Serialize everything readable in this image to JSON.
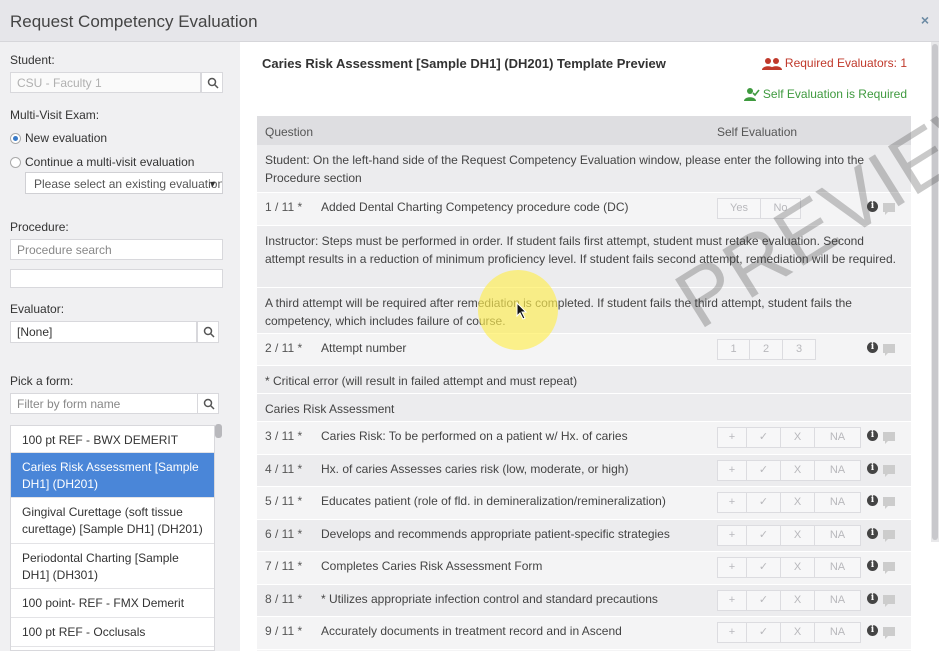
{
  "window": {
    "title": "Request Competency Evaluation",
    "close_glyph": "×"
  },
  "left": {
    "student_label": "Student:",
    "student_value": "CSU - Faculty 1",
    "multivisit_label": "Multi-Visit Exam:",
    "new_eval_label": "New evaluation",
    "continue_label": "Continue a multi-visit evaluation",
    "existing_select": "Please select an existing evaluation",
    "procedure_label": "Procedure:",
    "procedure_placeholder": "Procedure search",
    "evaluator_label": "Evaluator:",
    "evaluator_value": "[None]",
    "form_label": "Pick a form:",
    "form_filter_placeholder": "Filter by form name",
    "forms": [
      "100 pt REF - BWX DEMERIT",
      "Caries Risk Assessment [Sample DH1] (DH201)",
      "Gingival Curettage (soft tissue curettage) [Sample DH1] (DH201)",
      "Periodontal Charting [Sample DH1] (DH301)",
      "100 point- REF - FMX Demerit",
      "100 pt REF - Occlusals"
    ]
  },
  "main": {
    "title": "Caries Risk Assessment [Sample DH1] (DH201) Template Preview",
    "required_evaluators": "Required Evaluators: 1",
    "self_eval_required": "Self Evaluation is Required",
    "col_question": "Question",
    "col_self": "Self Evaluation",
    "watermark": "PREVIEW",
    "instructions": [
      "Student: On the left-hand side of the Request Competency Evaluation window, please enter the following into the Procedure section",
      "Instructor: Steps must be performed in order. If student fails first attempt, student must retake evaluation. Second attempt results in a reduction of minimum proficiency level. If student fails second attempt, remediation will be required.",
      "A third attempt will be required after remediation is completed. If student fails the third attempt, student fails the competency, which includes failure of course.",
      "* Critical error (will result in failed attempt and must repeat)",
      "Caries Risk Assessment"
    ],
    "questions": [
      {
        "num": "1 / 11 *",
        "text": "Added Dental Charting Competency procedure code (DC)",
        "options": [
          "Yes",
          "No"
        ]
      },
      {
        "num": "2 / 11 *",
        "text": "Attempt number",
        "options": [
          "1",
          "2",
          "3"
        ]
      },
      {
        "num": "3 / 11 *",
        "text": "Caries Risk: To be performed on a patient w/ Hx. of caries",
        "options": [
          "+",
          "✓",
          "X",
          "NA"
        ]
      },
      {
        "num": "4 / 11 *",
        "text": "Hx. of caries Assesses caries risk (low, moderate, or high)",
        "options": [
          "+",
          "✓",
          "X",
          "NA"
        ]
      },
      {
        "num": "5 / 11 *",
        "text": "Educates patient (role of fld. in demineralization/remineralization)",
        "options": [
          "+",
          "✓",
          "X",
          "NA"
        ]
      },
      {
        "num": "6 / 11 *",
        "text": "Develops and recommends appropriate patient-specific strategies",
        "options": [
          "+",
          "✓",
          "X",
          "NA"
        ]
      },
      {
        "num": "7 / 11 *",
        "text": "Completes Caries Risk Assessment Form",
        "options": [
          "+",
          "✓",
          "X",
          "NA"
        ]
      },
      {
        "num": "8 / 11 *",
        "text": "* Utilizes appropriate infection control and standard precautions",
        "options": [
          "+",
          "✓",
          "X",
          "NA"
        ]
      },
      {
        "num": "9 / 11 *",
        "text": "Accurately documents in treatment record and in Ascend",
        "options": [
          "+",
          "✓",
          "X",
          "NA"
        ]
      }
    ]
  }
}
